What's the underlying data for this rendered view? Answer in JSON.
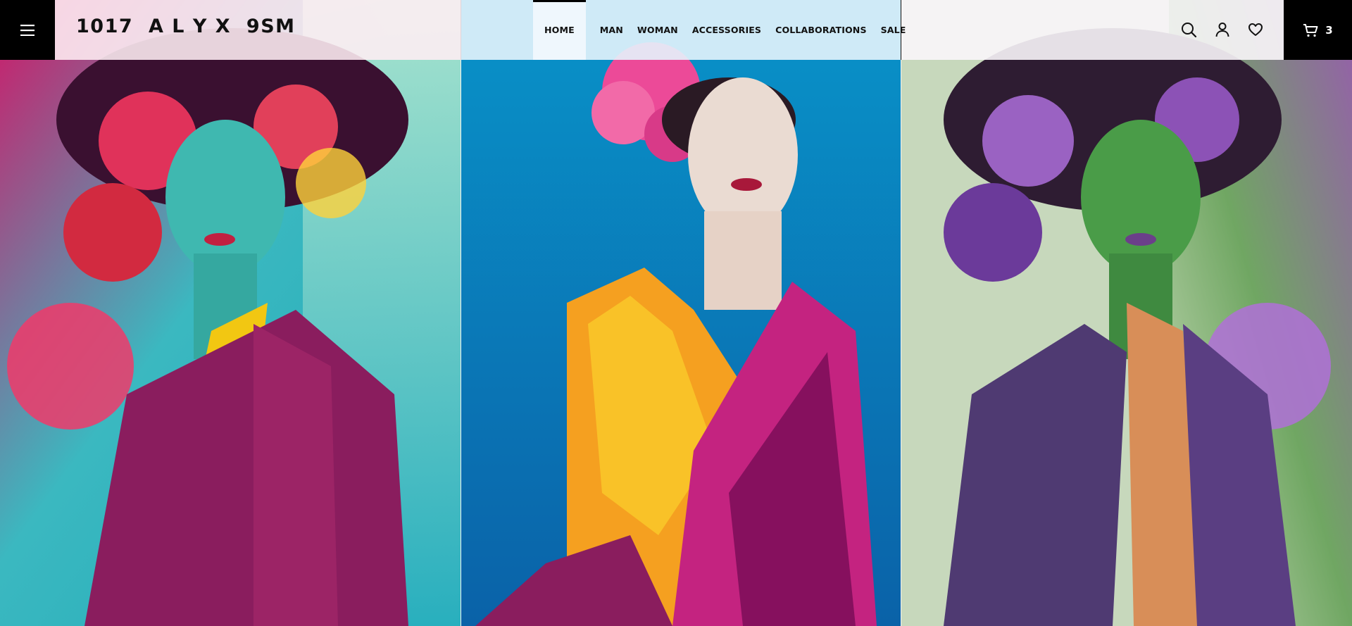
{
  "header": {
    "brand": "1017  A L Y X  9SM",
    "nav": [
      {
        "label": "HOME",
        "active": true
      },
      {
        "label": "MAN"
      },
      {
        "label": "WOMAN"
      },
      {
        "label": "ACCESSORIES"
      },
      {
        "label": "COLLABORATIONS"
      },
      {
        "label": "SALE"
      }
    ],
    "icons": [
      "menu-icon",
      "search-icon",
      "account-icon",
      "wishlist-heart-icon",
      "cart-icon"
    ],
    "cart_count": "3"
  },
  "hero": {
    "panels": [
      {
        "name": "left",
        "colors": [
          "#cf1e6e",
          "#4fc3c1",
          "#a8e3cf",
          "#8a2a6a",
          "#f0d020"
        ]
      },
      {
        "name": "center",
        "colors": [
          "#0a8cc6",
          "#0a5fa6",
          "#ec4fa2",
          "#f7a01a",
          "#c8247e"
        ]
      },
      {
        "name": "right",
        "colors": [
          "#c6d9b9",
          "#7b4aa8",
          "#4a9f4a",
          "#4d3a70",
          "#d88848"
        ]
      }
    ]
  }
}
